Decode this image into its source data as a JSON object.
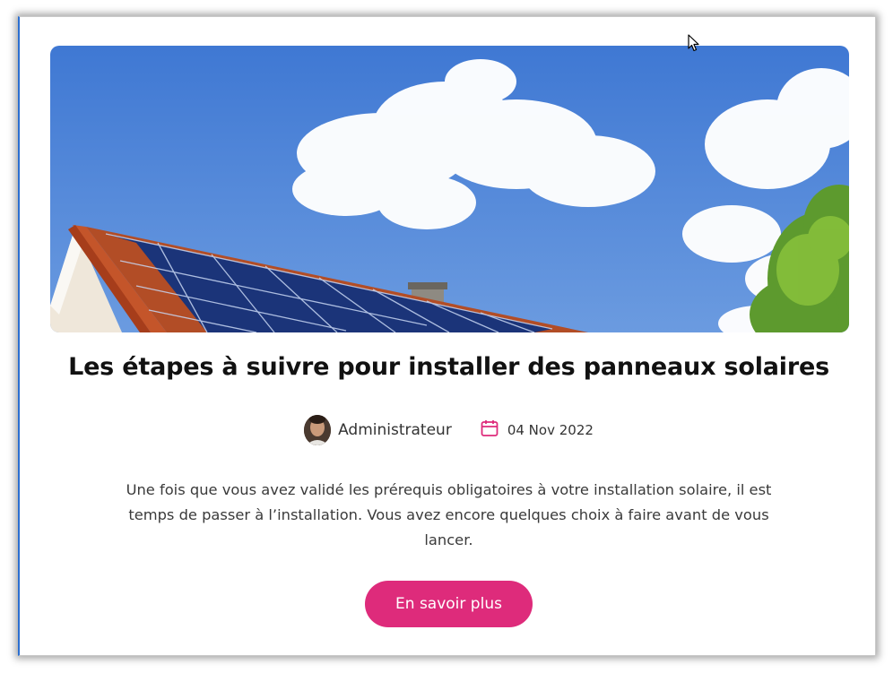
{
  "article": {
    "title": "Les étapes à suivre pour installer des panneaux solaires",
    "author": "Administrateur",
    "date": "04 Nov 2022",
    "excerpt": "Une fois que vous avez validé les prérequis obligatoires à votre installation solaire, il est temps de passer à l’installation. Vous avez encore quelques choix à faire avant de vous lancer.",
    "cta_label": "En savoir plus"
  },
  "colors": {
    "accent": "#de2b7b",
    "sky": "#4f86d9",
    "title_text": "#111111"
  },
  "icons": {
    "date": "calendar-icon",
    "author": "avatar",
    "pointer": "cursor-icon"
  }
}
